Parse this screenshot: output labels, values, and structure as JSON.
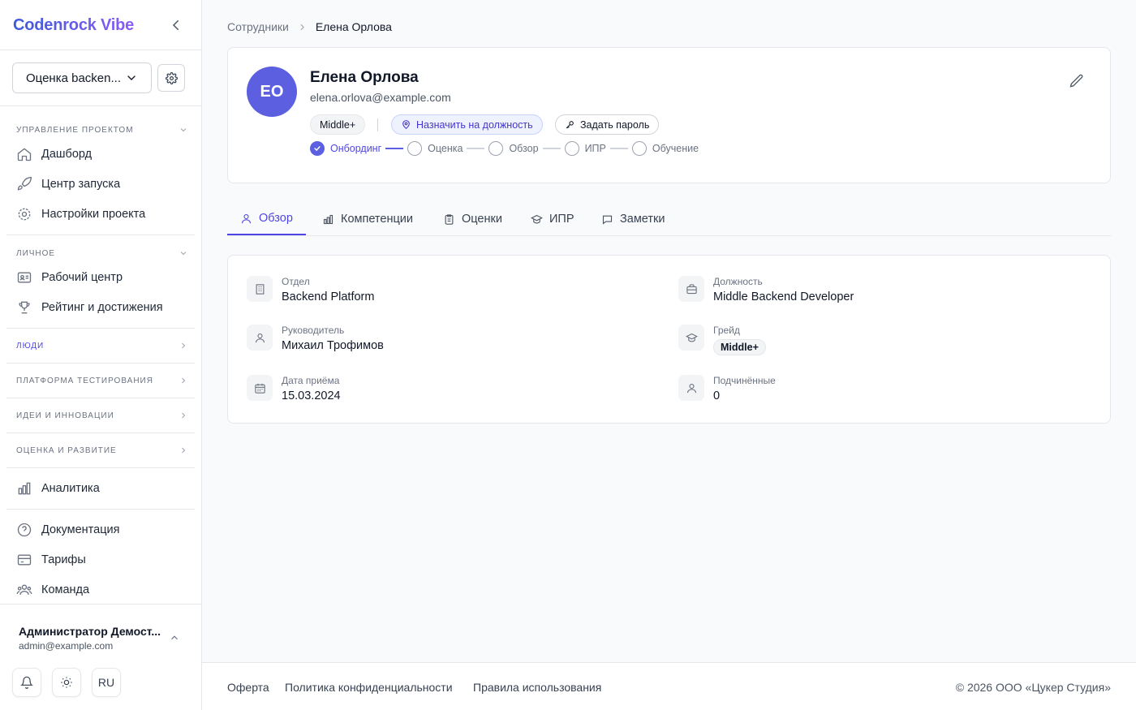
{
  "sidebar": {
    "brand": "Codenrock Vibe",
    "project_select": "Оценка backen...",
    "sections": [
      {
        "label": "Управление проектом",
        "items": [
          "Дашборд",
          "Центр запуска",
          "Настройки проекта"
        ]
      },
      {
        "label": "Личное",
        "items": [
          "Рабочий центр",
          "Рейтинг и достижения"
        ]
      },
      {
        "label": "Люди"
      },
      {
        "label": "Платформа тестирования"
      },
      {
        "label": "Идеи и инновации"
      },
      {
        "label": "Оценка и развитие"
      }
    ],
    "analytics": "Аналитика",
    "bottom_items": [
      "Документация",
      "Тарифы",
      "Команда"
    ],
    "user": {
      "name": "Администратор Демост...",
      "email": "admin@example.com"
    },
    "lang": "RU"
  },
  "breadcrumb": {
    "parent": "Сотрудники",
    "current": "Елена Орлова"
  },
  "profile": {
    "initials": "ЕО",
    "name": "Елена Орлова",
    "email": "elena.orlova@example.com",
    "grade": "Middle+",
    "assign_label": "Назначить на должность",
    "password_label": "Задать пароль",
    "steps": [
      "Онбординг",
      "Оценка",
      "Обзор",
      "ИПР",
      "Обучение"
    ]
  },
  "tabs": [
    "Обзор",
    "Компетенции",
    "Оценки",
    "ИПР",
    "Заметки"
  ],
  "overview": {
    "department_label": "Отдел",
    "department": "Backend Platform",
    "position_label": "Должность",
    "position": "Middle Backend Developer",
    "manager_label": "Руководитель",
    "manager": "Михаил Трофимов",
    "grade_label": "Грейд",
    "grade": "Middle+",
    "hire_label": "Дата приёма",
    "hire_date": "15.03.2024",
    "subs_label": "Подчинённые",
    "subs": "0"
  },
  "footer": {
    "links": [
      "Оферта",
      "Политика конфиденциальности",
      "Правила использования"
    ],
    "copyright": "© 2026 ООО «Цукер Студия»"
  },
  "colors": {
    "accent": "#4f46e5",
    "avatar": "#5b5fe0"
  }
}
